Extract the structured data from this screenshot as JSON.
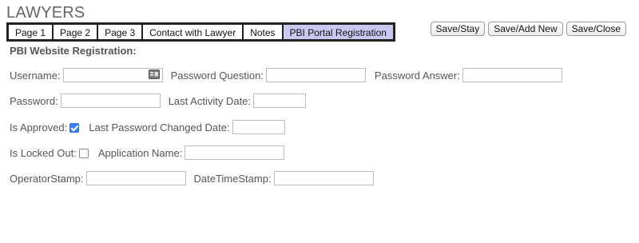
{
  "app": {
    "title": "LAWYERS"
  },
  "tabs": [
    {
      "label": "Page 1",
      "active": false
    },
    {
      "label": "Page 2",
      "active": false
    },
    {
      "label": "Page 3",
      "active": false
    },
    {
      "label": "Contact with Lawyer",
      "active": false
    },
    {
      "label": "Notes",
      "active": false
    },
    {
      "label": "PBI Portal Registration",
      "active": true
    }
  ],
  "actions": {
    "save_stay": "Save/Stay",
    "save_add_new": "Save/Add New",
    "save_close": "Save/Close"
  },
  "section": {
    "title": "PBI Website Registration:"
  },
  "fields": {
    "username": {
      "label": "Username:",
      "value": ""
    },
    "password_question": {
      "label": "Password Question:",
      "value": ""
    },
    "password_answer": {
      "label": "Password Answer:",
      "value": ""
    },
    "password": {
      "label": "Password:",
      "value": ""
    },
    "last_activity_date": {
      "label": "Last Activity Date:",
      "value": ""
    },
    "is_approved": {
      "label": "Is Approved:",
      "checked": true
    },
    "last_password_changed_date": {
      "label": "Last Password Changed Date:",
      "value": ""
    },
    "is_locked_out": {
      "label": "Is Locked Out:",
      "checked": false
    },
    "application_name": {
      "label": "Application Name:",
      "value": ""
    },
    "operator_stamp": {
      "label": "OperatorStamp:",
      "value": ""
    },
    "date_time_stamp": {
      "label": "DateTimeStamp:",
      "value": ""
    }
  },
  "icons": {
    "username_lookup": "contact-card-icon"
  },
  "colors": {
    "active_tab": "#c8c8f0",
    "checkbox_checked": "#3b82f6"
  }
}
